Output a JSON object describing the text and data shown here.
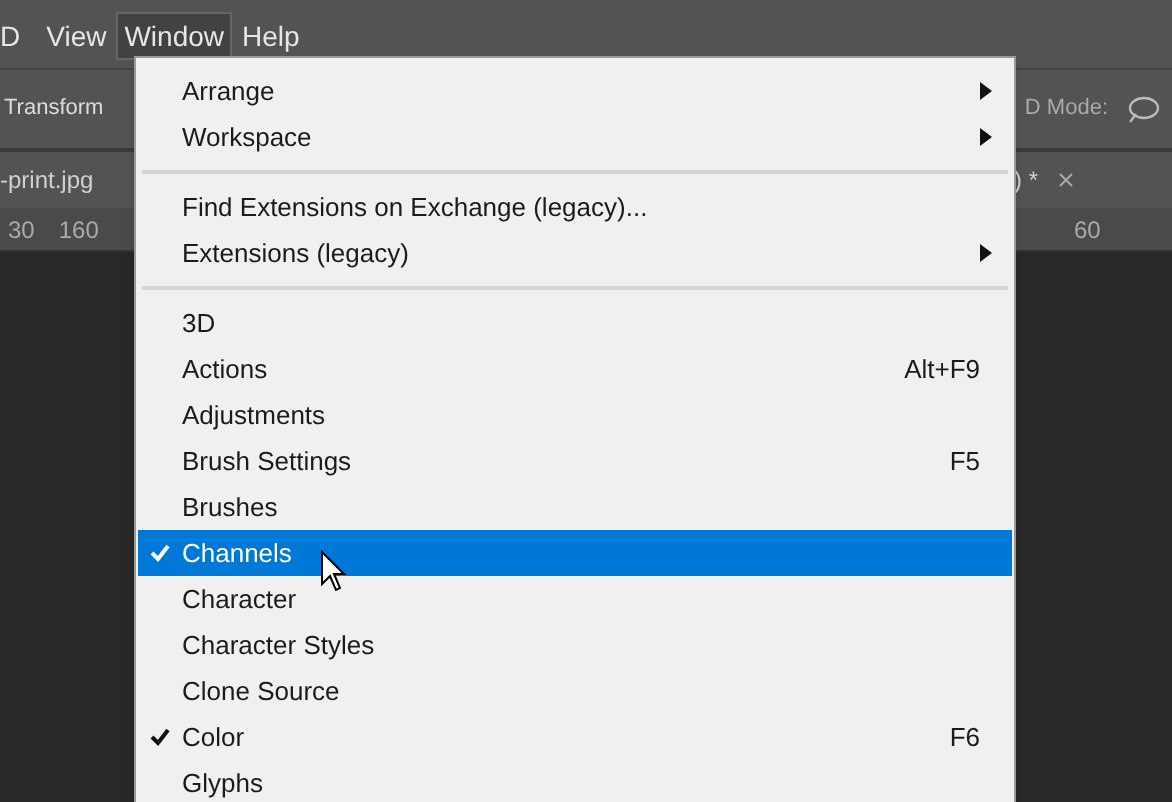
{
  "menubar": [
    {
      "label": "D",
      "selected": false
    },
    {
      "label": "View",
      "selected": false
    },
    {
      "label": "Window",
      "selected": true
    },
    {
      "label": "Help",
      "selected": false
    }
  ],
  "options_bar": {
    "left_text": "Transform",
    "right_text": "D Mode:"
  },
  "document_tabs": [
    {
      "label": "-print.jpg"
    },
    {
      "label": ") *"
    }
  ],
  "ruler": {
    "left_ticks": [
      "30",
      "160"
    ],
    "right_ticks": [
      "60"
    ]
  },
  "menu": [
    {
      "kind": "item",
      "label": "Arrange",
      "submenu": true,
      "checked": false,
      "selected": false
    },
    {
      "kind": "item",
      "label": "Workspace",
      "submenu": true,
      "checked": false,
      "selected": false
    },
    {
      "kind": "separator"
    },
    {
      "kind": "item",
      "label": "Find Extensions on Exchange (legacy)...",
      "submenu": false,
      "checked": false,
      "selected": false
    },
    {
      "kind": "item",
      "label": "Extensions (legacy)",
      "submenu": true,
      "checked": false,
      "selected": false
    },
    {
      "kind": "separator"
    },
    {
      "kind": "item",
      "label": "3D",
      "submenu": false,
      "checked": false,
      "selected": false
    },
    {
      "kind": "item",
      "label": "Actions",
      "shortcut": "Alt+F9",
      "submenu": false,
      "checked": false,
      "selected": false
    },
    {
      "kind": "item",
      "label": "Adjustments",
      "submenu": false,
      "checked": false,
      "selected": false
    },
    {
      "kind": "item",
      "label": "Brush Settings",
      "shortcut": "F5",
      "submenu": false,
      "checked": false,
      "selected": false
    },
    {
      "kind": "item",
      "label": "Brushes",
      "submenu": false,
      "checked": false,
      "selected": false
    },
    {
      "kind": "item",
      "label": "Channels",
      "submenu": false,
      "checked": true,
      "selected": true
    },
    {
      "kind": "item",
      "label": "Character",
      "submenu": false,
      "checked": false,
      "selected": false
    },
    {
      "kind": "item",
      "label": "Character Styles",
      "submenu": false,
      "checked": false,
      "selected": false
    },
    {
      "kind": "item",
      "label": "Clone Source",
      "submenu": false,
      "checked": false,
      "selected": false
    },
    {
      "kind": "item",
      "label": "Color",
      "shortcut": "F6",
      "submenu": false,
      "checked": true,
      "selected": false
    },
    {
      "kind": "item",
      "label": "Glyphs",
      "submenu": false,
      "checked": false,
      "selected": false
    }
  ]
}
